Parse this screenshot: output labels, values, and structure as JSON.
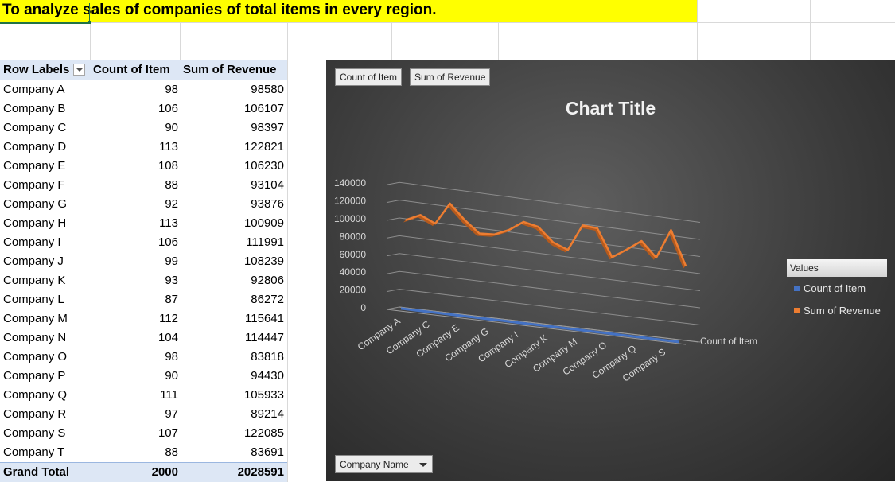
{
  "sheet": {
    "banner_text": "To analyze sales of companies of total items in every region."
  },
  "pivot": {
    "headers": {
      "row_labels": "Row Labels",
      "count": "Count of Item",
      "sum": "Sum of Revenue"
    },
    "rows": [
      {
        "label": "Company A",
        "count": "98",
        "sum": "98580"
      },
      {
        "label": "Company B",
        "count": "106",
        "sum": "106107"
      },
      {
        "label": "Company C",
        "count": "90",
        "sum": "98397"
      },
      {
        "label": "Company D",
        "count": "113",
        "sum": "122821"
      },
      {
        "label": "Company E",
        "count": "108",
        "sum": "106230"
      },
      {
        "label": "Company F",
        "count": "88",
        "sum": "93104"
      },
      {
        "label": "Company G",
        "count": "92",
        "sum": "93876"
      },
      {
        "label": "Company H",
        "count": "113",
        "sum": "100909"
      },
      {
        "label": "Company I",
        "count": "106",
        "sum": "111991"
      },
      {
        "label": "Company J",
        "count": "99",
        "sum": "108239"
      },
      {
        "label": "Company K",
        "count": "93",
        "sum": "92806"
      },
      {
        "label": "Company L",
        "count": "87",
        "sum": "86272"
      },
      {
        "label": "Company M",
        "count": "112",
        "sum": "115641"
      },
      {
        "label": "Company N",
        "count": "104",
        "sum": "114447"
      },
      {
        "label": "Company O",
        "count": "98",
        "sum": "83818"
      },
      {
        "label": "Company P",
        "count": "90",
        "sum": "94430"
      },
      {
        "label": "Company Q",
        "count": "111",
        "sum": "105933"
      },
      {
        "label": "Company R",
        "count": "97",
        "sum": "89214"
      },
      {
        "label": "Company S",
        "count": "107",
        "sum": "122085"
      },
      {
        "label": "Company T",
        "count": "88",
        "sum": "83691"
      }
    ],
    "total": {
      "label": "Grand Total",
      "count": "2000",
      "sum": "2028591"
    }
  },
  "chart": {
    "field_buttons": [
      "Count of Item",
      "Sum of Revenue"
    ],
    "title": "Chart Title",
    "legend_title": "Values",
    "legend_items": [
      {
        "label": "Count of Item",
        "color": "#4472c4"
      },
      {
        "label": "Sum of Revenue",
        "color": "#ed7d31"
      }
    ],
    "depth_axis_label": "Count of Item",
    "axis_field_button": "Company Name",
    "dropdown_icon": "chevron-down-icon"
  },
  "chart_data": {
    "type": "line",
    "title": "Chart Title",
    "categories": [
      "Company A",
      "Company B",
      "Company C",
      "Company D",
      "Company E",
      "Company F",
      "Company G",
      "Company H",
      "Company I",
      "Company J",
      "Company K",
      "Company L",
      "Company M",
      "Company N",
      "Company O",
      "Company P",
      "Company Q",
      "Company R",
      "Company S",
      "Company T"
    ],
    "category_tick_labels": [
      "Company A",
      "Company C",
      "Company E",
      "Company G",
      "Company I",
      "Company K",
      "Company M",
      "Company O",
      "Company Q",
      "Company S"
    ],
    "series": [
      {
        "name": "Count of Item",
        "color": "#4472c4",
        "values": [
          98,
          106,
          90,
          113,
          108,
          88,
          92,
          113,
          106,
          99,
          93,
          87,
          112,
          104,
          98,
          90,
          111,
          97,
          107,
          88
        ]
      },
      {
        "name": "Sum of Revenue",
        "color": "#ed7d31",
        "values": [
          98580,
          106107,
          98397,
          122821,
          106230,
          93104,
          93876,
          100909,
          111991,
          108239,
          92806,
          86272,
          115641,
          114447,
          83818,
          94430,
          105933,
          89214,
          122085,
          83691
        ]
      }
    ],
    "yticks": [
      "0",
      "20000",
      "40000",
      "60000",
      "80000",
      "100000",
      "120000",
      "140000"
    ],
    "ylim": [
      0,
      140000
    ],
    "legend_position": "right",
    "style": "3-D line"
  }
}
